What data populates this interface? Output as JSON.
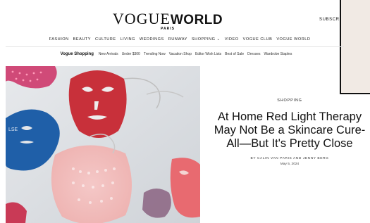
{
  "brand": {
    "vogue": "VOGUE",
    "world": "WORLD",
    "city": "PARIS"
  },
  "header": {
    "subscribe_label": "SUBSCRIB"
  },
  "primary_nav": [
    "FASHION",
    "BEAUTY",
    "CULTURE",
    "LIVING",
    "WEDDINGS",
    "RUNWAY",
    "SHOPPING ⌄",
    "VIDEO",
    "VOGUE CLUB",
    "VOGUE WORLD"
  ],
  "secondary_nav": {
    "title": "Vogue Shopping",
    "items": [
      "New Arrivals",
      "Under $300",
      "Trending Now",
      "Vacation Shop",
      "Editor Wish Lists",
      "Best of Sale",
      "Dresses",
      "Wardrobe Staples"
    ]
  },
  "hero": {
    "image": "red-light-therapy-masks-photo"
  },
  "article": {
    "kicker": "SHOPPING",
    "headline": "At Home Red Light Therapy May Not Be a Skincare Cure-All—But It's Pretty Close",
    "byline": "BY CALIN VAN PARIS AND JENNY BERG",
    "date": "May 5, 2024"
  },
  "colors": {
    "panel_bg": "#f1eae4",
    "text": "#111111",
    "mask_red": "#c8303a",
    "mask_blue": "#1f5fa8",
    "mask_pink": "#e86a70"
  }
}
